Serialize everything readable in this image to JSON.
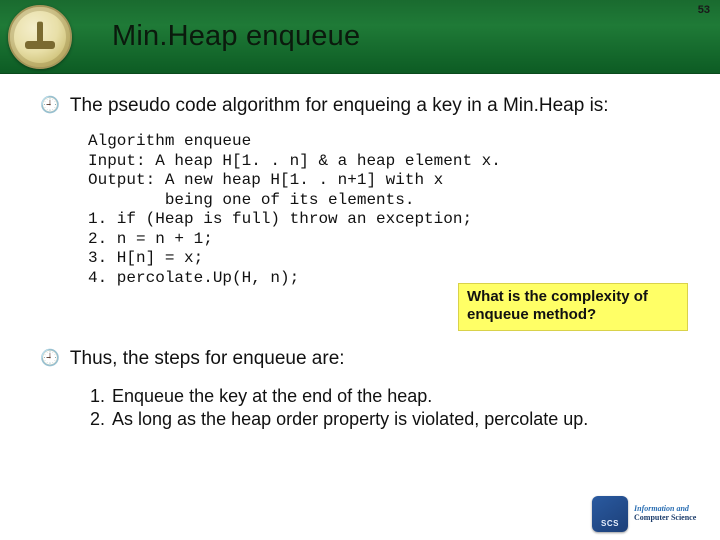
{
  "page_number": "53",
  "title": "Min.Heap enqueue",
  "intro": "The pseudo code algorithm for enqueing a key in a Min.Heap is:",
  "algo": {
    "l1": "Algorithm enqueue",
    "l2": "Input: A heap H[1. . n] & a heap element x.",
    "l3": "Output: A new heap H[1. . n+1] with x",
    "l4": "        being one of its elements.",
    "l5": "1. if (Heap is full) throw an exception;",
    "l6": "2. n = n + 1;",
    "l7": "3. H[n] = x;",
    "l8": "4. percolate.Up(H, n);"
  },
  "callout": "What is the complexity of enqueue method?",
  "thus": "Thus, the steps for enqueue are:",
  "steps": {
    "s1": "Enqueue the key at the end of the heap.",
    "s2": "As long as the heap order property is violated, percolate up."
  },
  "footer": {
    "line1": "Information and",
    "line2": "Computer Science"
  }
}
